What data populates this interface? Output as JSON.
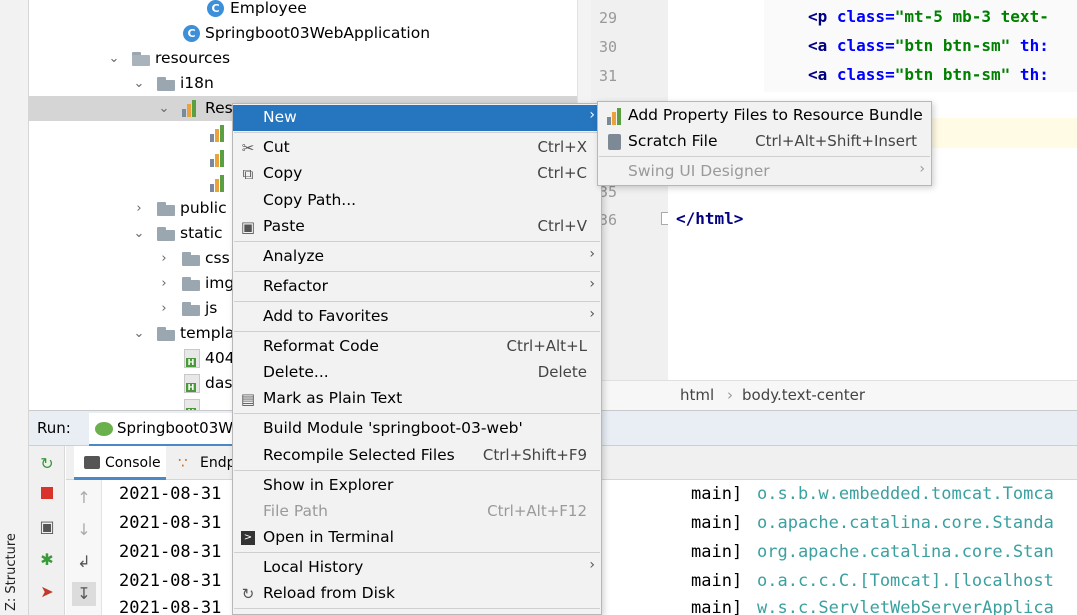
{
  "project_tree": {
    "items": [
      {
        "label": "Employee",
        "icon": "class-icon"
      },
      {
        "label": "Springboot03WebApplication",
        "icon": "class-icon"
      },
      {
        "label": "resources",
        "icon": "resources-folder-icon"
      },
      {
        "label": "i18n",
        "icon": "folder-icon"
      },
      {
        "label": "Res",
        "icon": "resource-bundle-icon"
      },
      {
        "label": "public",
        "icon": "folder-icon"
      },
      {
        "label": "static",
        "icon": "folder-icon"
      },
      {
        "label": "css",
        "icon": "folder-icon"
      },
      {
        "label": "img",
        "icon": "folder-icon"
      },
      {
        "label": "js",
        "icon": "folder-icon"
      },
      {
        "label": "templa",
        "icon": "folder-icon"
      },
      {
        "label": "404",
        "icon": "html-file-icon"
      },
      {
        "label": "dasl",
        "icon": "html-file-icon"
      }
    ]
  },
  "editor": {
    "line_numbers": [
      "29",
      "30",
      "31",
      "35",
      "36"
    ],
    "code_lines": [
      {
        "tag": "<p",
        "attr": " class=",
        "str": "\"mt-5 mb-3 text-"
      },
      {
        "tag": "<a",
        "attr": " class=",
        "str": "\"btn btn-sm\"",
        "tail": " th:"
      },
      {
        "tag": "<a",
        "attr": " class=",
        "str": "\"btn btn-sm\"",
        "tail": " th:"
      },
      {
        "tag": "</html>"
      }
    ],
    "breadcrumb": [
      "html",
      "body.text-center"
    ]
  },
  "run_panel": {
    "label": "Run:",
    "tab": "Springboot03W",
    "subtabs": [
      "Console",
      "Endp"
    ],
    "log_lines": [
      {
        "date": "2021-08-31",
        "thread": "main]",
        "logger": "o.s.b.w.embedded.tomcat.Tomca"
      },
      {
        "date": "2021-08-31",
        "thread": "main]",
        "logger": "o.apache.catalina.core.Standa"
      },
      {
        "date": "2021-08-31",
        "thread": "main]",
        "logger": "org.apache.catalina.core.Stan"
      },
      {
        "date": "2021-08-31",
        "thread": "main]",
        "logger": "o.a.c.c.C.[Tomcat].[localhost"
      },
      {
        "date": "2021-08-31",
        "thread": "main]",
        "logger": "w.s.c.ServletWebServerApplica"
      }
    ]
  },
  "structure_tab": "Z: Structure",
  "context_menu": {
    "items": [
      {
        "label": "New",
        "has_submenu": true,
        "active": true
      },
      {
        "label": "Cut",
        "shortcut": "Ctrl+X",
        "icon": "scissors-icon"
      },
      {
        "label": "Copy",
        "shortcut": "Ctrl+C",
        "icon": "copy-icon"
      },
      {
        "label": "Copy Path...",
        "shortcut": ""
      },
      {
        "label": "Paste",
        "shortcut": "Ctrl+V",
        "icon": "paste-icon"
      },
      {
        "label": "Analyze",
        "has_submenu": true
      },
      {
        "label": "Refactor",
        "has_submenu": true
      },
      {
        "label": "Add to Favorites",
        "has_submenu": true
      },
      {
        "label": "Reformat Code",
        "shortcut": "Ctrl+Alt+L"
      },
      {
        "label": "Delete...",
        "shortcut": "Delete"
      },
      {
        "label": "Mark as Plain Text",
        "icon": "plain-text-icon"
      },
      {
        "label": "Build Module 'springboot-03-web'"
      },
      {
        "label": "Recompile Selected Files",
        "shortcut": "Ctrl+Shift+F9"
      },
      {
        "label": "Show in Explorer"
      },
      {
        "label": "File Path",
        "shortcut": "Ctrl+Alt+F12",
        "disabled": true
      },
      {
        "label": "Open in Terminal",
        "icon": "terminal-icon"
      },
      {
        "label": "Local History",
        "has_submenu": true
      },
      {
        "label": "Reload from Disk",
        "icon": "reload-icon"
      }
    ]
  },
  "submenu": {
    "items": [
      {
        "label": "Add Property Files to Resource Bundle",
        "icon": "resource-bundle-icon"
      },
      {
        "label": "Scratch File",
        "shortcut": "Ctrl+Alt+Shift+Insert",
        "icon": "scratch-file-icon"
      },
      {
        "label": "Swing UI Designer",
        "has_submenu": true,
        "disabled": true
      }
    ]
  }
}
